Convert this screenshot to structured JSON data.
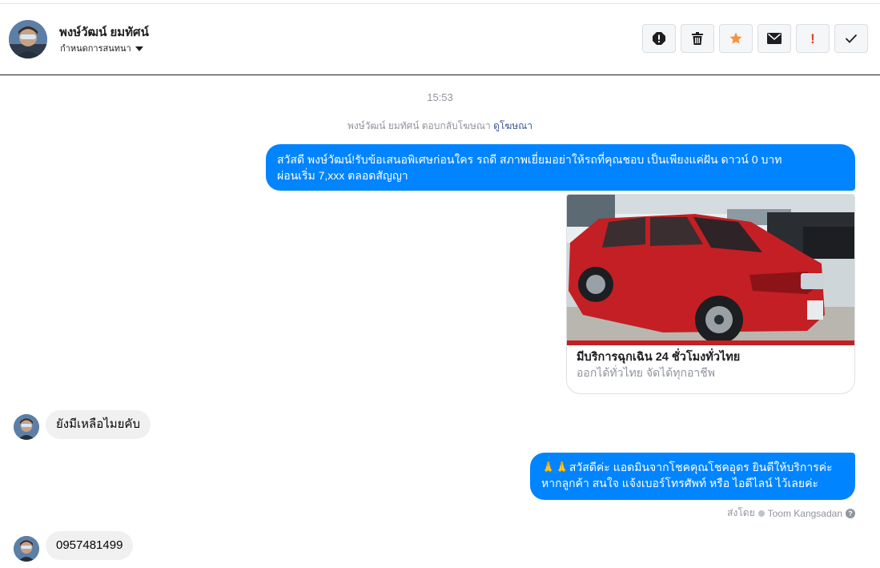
{
  "header": {
    "name": "พงษ์วัฒน์ ยมทัศน์",
    "subtitle": "กำหนดการสนทนา",
    "toolbar": [
      {
        "name": "alert-icon"
      },
      {
        "name": "trash-icon"
      },
      {
        "name": "star-icon"
      },
      {
        "name": "envelope-icon"
      },
      {
        "name": "exclamation-icon"
      },
      {
        "name": "check-icon"
      }
    ]
  },
  "thread": {
    "timestamp": "15:53",
    "context_prefix": "พงษ์วัฒน์ ยมทัศน์ ตอบกลับโฆษณา",
    "context_link": "ดูโฆษณา",
    "outgoing_1_line1": "สวัสดี พงษ์วัฒน์!รับข้อเสนอพิเศษก่อนใคร รถดี สภาพเยี่ยมอย่าให้รถที่คุณชอบ เป็นเพียงแค่ฝัน ดาวน์ 0 บาท",
    "outgoing_1_line2": "ผ่อนเริ่ม 7,xxx ตลอดสัญญา",
    "card_title": "มีบริการฉุกเฉิน 24 ชั่วโมงทั่วไทย",
    "card_subtitle": "ออกได้ทั่วไทย จัดได้ทุกอาชีพ",
    "incoming_1": "ยังมีเหลือไมยคับ",
    "outgoing_2_emoji": "🙏🙏",
    "outgoing_2_line1": "สวัสดีค่ะ แอดมินจากโชคคุณโชคอุดร ยินดีให้บริการค่ะ",
    "outgoing_2_line2": "หากลูกค้า สนใจ แจ้งเบอร์โทรศัพท์ หรือ ไอดีไลน์  ไว้เลยค่ะ",
    "sent_by_label": "ส่งโดย",
    "sent_by_name": "Toom Kangsadan",
    "incoming_2": "0957481499"
  },
  "colors": {
    "outgoing_bubble": "#0084ff",
    "incoming_bubble": "#f1f0f0",
    "star": "#f7923a",
    "exclamation": "#e0402b"
  }
}
